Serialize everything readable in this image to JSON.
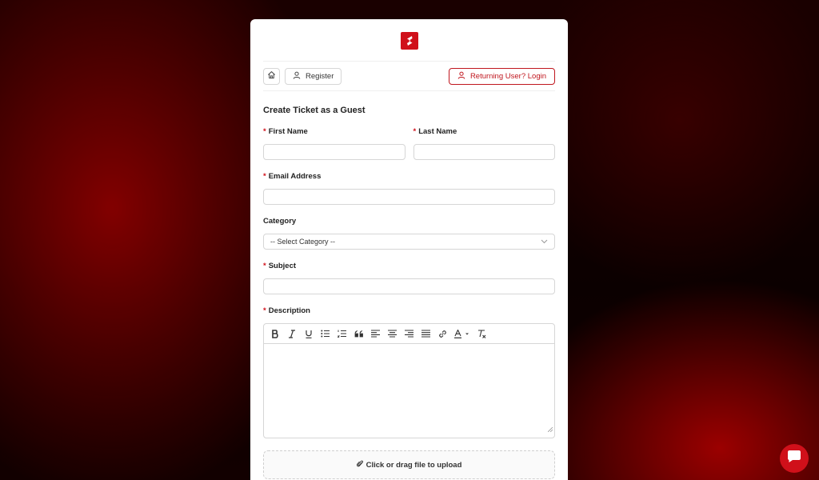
{
  "nav": {
    "register_label": "Register",
    "login_label": "Returning User? Login"
  },
  "form": {
    "title": "Create Ticket as a Guest",
    "required_marker": "*",
    "first_name": {
      "label": "First Name",
      "value": ""
    },
    "last_name": {
      "label": "Last Name",
      "value": ""
    },
    "email": {
      "label": "Email Address",
      "value": ""
    },
    "category": {
      "label": "Category",
      "selected": "-- Select Category --"
    },
    "subject": {
      "label": "Subject",
      "value": ""
    },
    "description": {
      "label": "Description"
    },
    "upload_label": "Click or drag file to upload"
  },
  "editor_toolbar": [
    "bold-icon",
    "italic-icon",
    "underline-icon",
    "bullet-list-icon",
    "ordered-list-icon",
    "blockquote-icon",
    "align-left-icon",
    "align-center-icon",
    "align-right-icon",
    "align-justify-icon",
    "link-icon",
    "text-color-icon",
    "clear-format-icon"
  ],
  "colors": {
    "brand": "#d0101a",
    "accent_border": "#c0161e"
  }
}
